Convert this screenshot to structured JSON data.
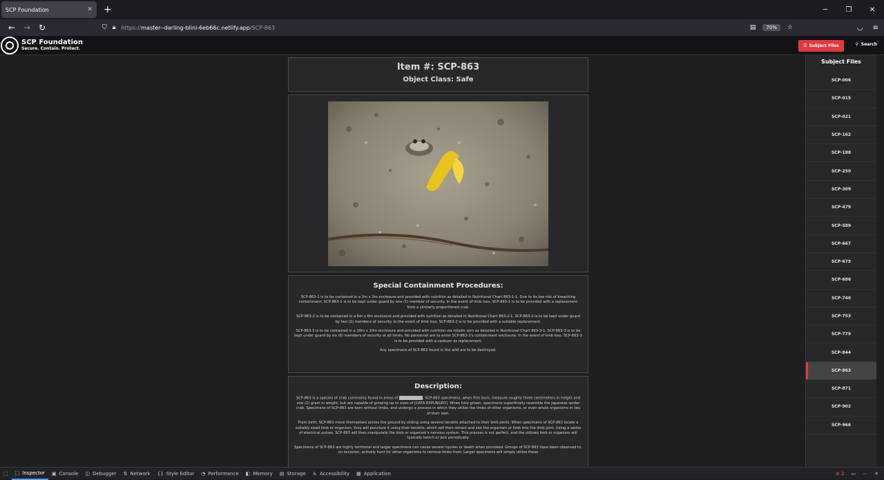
{
  "browser": {
    "tab_title": "SCP Foundation",
    "url_prefix": "https://",
    "url_host": "master--darling-blini-6eb66c.netlify.app",
    "url_path": "/SCP-863",
    "zoom": "70%"
  },
  "site": {
    "brand_title": "SCP Foundation",
    "brand_subtitle": "Secure. Contain. Protect.",
    "subject_files_button": "Subject Files",
    "search_button": "Search"
  },
  "item": {
    "title": "Item #: SCP-863",
    "object_class": "Object Class: Safe",
    "procedures_title": "Special Containment Procedures:",
    "procedures": [
      "SCP-863-1 is to be contained in a 2m x 2m enclosure and provided with nutrition as detailed in Nutritional Chart 863-1-1. Due to its low risk of breaching containment, SCP-863-1 is to be kept under guard by one (1) member of security. In the event of limb loss, SCP-863-1 is to be provided with a replacement from a similarly proportioned crab.",
      "SCP-863-2 is to be contained in a 6m x 6m enclosure and provided with nutrition as detailed in Nutritional Chart 863-2-1. SCP-863-2 is to be kept under guard by two (2) members of security. In the event of limb loss, SCP-863-2 is to be provided with a suitable replacement.",
      "SCP-863-3 is to be contained in a 10m x 10m enclosure and provided with nutrition via robotic arm as detailed in Nutritional Chart 863-3-1. SCP-863-3 is to be kept under guard by six (6) members of security at all times. No personnel are to enter SCP-863-3's containment enclosure. In the event of limb loss, SCP-863-3 is to be provided with a cadaver as replacement.",
      "Any specimens of SCP-863 found in the wild are to be destroyed."
    ],
    "description_title": "Description:",
    "description_p1_a": "SCP-863 is a species of crab commonly found in areas of ",
    "description_p1_b": ". SCP-863 specimens, when first born, measure roughly three centimeters in height and one (1) gram in weight, but are capable of growing up to sizes of [DATA EXPUNGED]. When fully grown, specimens superficially resemble the Japanese spider crab. Specimens of SCP-863 are born without limbs, and undergo a process in which they utilize the limbs of other organisms, or even whole organisms in lieu of their own.",
    "description_p2": "From birth, SCP-863 move themselves across the ground by sliding using several tendrils attached to their limb joints. When specimens of SCP-863 locate a suitably sized limb or organism, they will puncture it using their tendrils, which will then retract and slot the organism or limb into the limb joint. Using a series of electrical pulses, SCP-863 will then manipulate the limb or organism's nervous system. This process is not perfect, and the utilized limb or organism will typically twitch or jerk periodically.",
    "description_p3": "Specimens of SCP-863 are highly territorial and larger specimens can cause severe injuries or death when provoked. Groups of SCP-863 have been observed to, on occasion, actively hunt for other organisms to remove limbs from. Larger specimens will simply utilize these"
  },
  "sidebar": {
    "title": "Subject Files",
    "items": [
      "SCP-006",
      "SCP-015",
      "SCP-021",
      "SCP-162",
      "SCP-188",
      "SCP-250",
      "SCP-309",
      "SCP-479",
      "SCP-589",
      "SCP-667",
      "SCP-679",
      "SCP-686",
      "SCP-740",
      "SCP-753",
      "SCP-779",
      "SCP-844",
      "SCP-863",
      "SCP-871",
      "SCP-902",
      "SCP-966"
    ],
    "active": "SCP-863",
    "accent_color": "#e03a3e"
  },
  "devtools": {
    "tabs": [
      "Inspector",
      "Console",
      "Debugger",
      "Network",
      "Style Editor",
      "Performance",
      "Memory",
      "Storage",
      "Accessibility",
      "Application"
    ],
    "active": "Inspector",
    "error_count": "2"
  }
}
